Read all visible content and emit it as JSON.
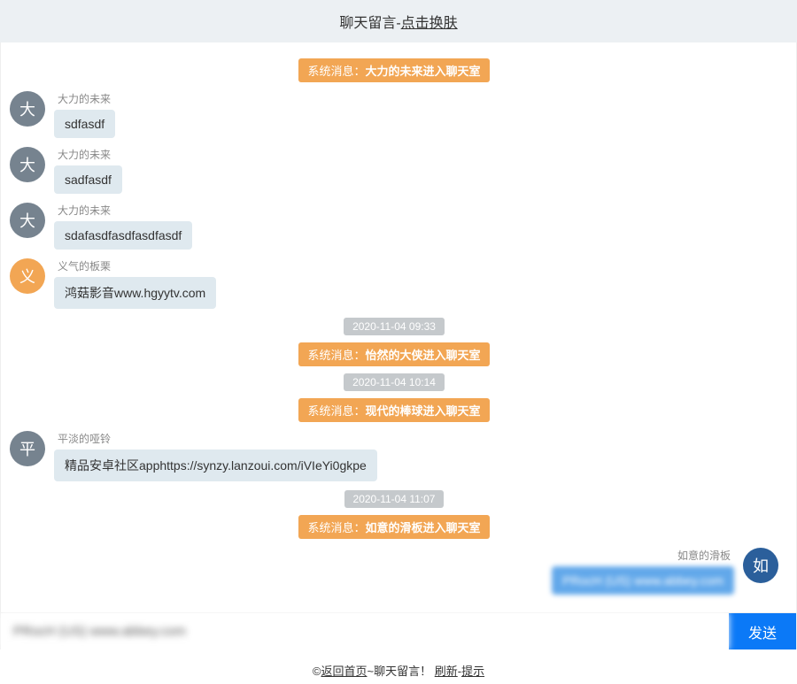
{
  "header": {
    "title": "聊天留言",
    "sep": "-",
    "link": "点击换肤"
  },
  "messages": [
    {
      "type": "system",
      "prefix": "系统消息：",
      "text": "大力的未来进入聊天室"
    },
    {
      "type": "msg",
      "side": "left",
      "avatar_char": "大",
      "avatar_color": "gray",
      "username": "大力的未来",
      "text": "sdfasdf"
    },
    {
      "type": "msg",
      "side": "left",
      "avatar_char": "大",
      "avatar_color": "gray",
      "username": "大力的未来",
      "text": "sadfasdf"
    },
    {
      "type": "msg",
      "side": "left",
      "avatar_char": "大",
      "avatar_color": "gray",
      "username": "大力的未来",
      "text": "sdafasdfasdfasdfasdf"
    },
    {
      "type": "msg",
      "side": "left",
      "avatar_char": "义",
      "avatar_color": "orange",
      "username": "义气的板栗",
      "text": "鸿菇影音www.hgyytv.com"
    },
    {
      "type": "time",
      "text": "2020-11-04 09:33"
    },
    {
      "type": "system",
      "prefix": "系统消息：",
      "text": "怡然的大侠进入聊天室"
    },
    {
      "type": "time",
      "text": "2020-11-04 10:14"
    },
    {
      "type": "system",
      "prefix": "系统消息：",
      "text": "现代的棒球进入聊天室"
    },
    {
      "type": "msg",
      "side": "left",
      "avatar_char": "平",
      "avatar_color": "gray",
      "username": "平淡的哑铃",
      "text": "精品安卓社区apphttps://synzy.lanzoui.com/iVIeYi0gkpe"
    },
    {
      "type": "time",
      "text": "2020-11-04 11:07"
    },
    {
      "type": "system",
      "prefix": "系统消息：",
      "text": "如意的滑板进入聊天室"
    },
    {
      "type": "msg",
      "side": "right",
      "avatar_char": "如",
      "avatar_color": "blue",
      "username": "如意的滑板",
      "text": "PRocH (US) www.abbey.com"
    }
  ],
  "input": {
    "value": "PRocH (US) www.abbey.com",
    "send_label": "发送"
  },
  "footer": {
    "copy": "©",
    "home_link": "返回首页",
    "mid": "~聊天留言！ ",
    "refresh_link": "刷新",
    "sep": "-",
    "tip_link": "提示"
  }
}
